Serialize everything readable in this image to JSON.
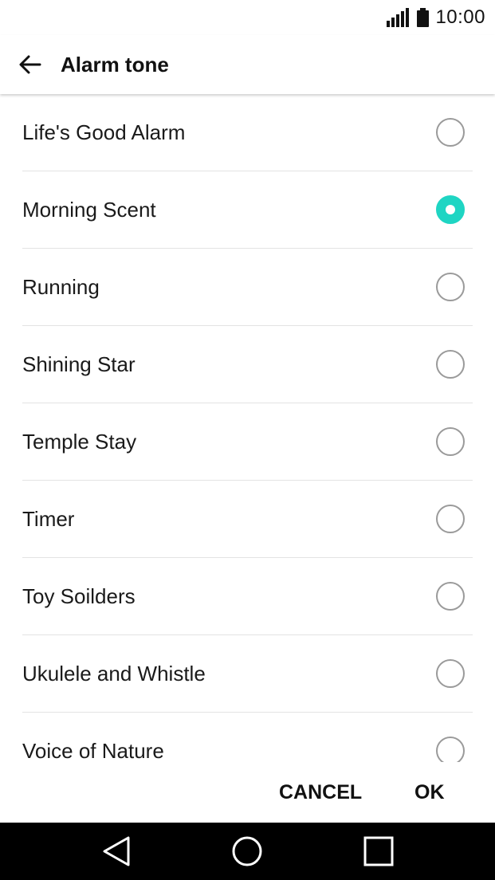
{
  "status_bar": {
    "time": "10:00",
    "signal_icon": "signal-icon",
    "battery_icon": "battery-icon"
  },
  "header": {
    "title": "Alarm tone",
    "back_icon": "arrow-back-icon"
  },
  "tones": [
    {
      "label": "Life's Good Alarm",
      "selected": false
    },
    {
      "label": "Morning Scent",
      "selected": true
    },
    {
      "label": "Running",
      "selected": false
    },
    {
      "label": "Shining Star",
      "selected": false
    },
    {
      "label": "Temple Stay",
      "selected": false
    },
    {
      "label": "Timer",
      "selected": false
    },
    {
      "label": "Toy Soilders",
      "selected": false
    },
    {
      "label": "Ukulele and Whistle",
      "selected": false
    },
    {
      "label": "Voice of Nature",
      "selected": false
    }
  ],
  "actions": {
    "cancel_label": "CANCEL",
    "ok_label": "OK"
  },
  "colors": {
    "accent": "#1fd5c3",
    "nav_bar": "#000000"
  },
  "nav_bar": {
    "back_icon": "nav-back-triangle-icon",
    "home_icon": "nav-home-circle-icon",
    "recents_icon": "nav-recents-square-icon"
  }
}
